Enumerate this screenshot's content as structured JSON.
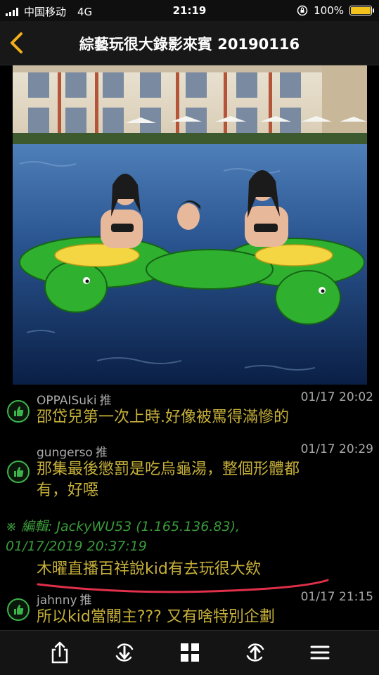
{
  "status": {
    "carrier": "中国移动",
    "network": "4G",
    "time": "21:19",
    "battery": "100%",
    "battery_color": "#f2c21b"
  },
  "nav": {
    "back_icon": "chevron-left-icon",
    "title": "綜藝玩很大錄影來賓 20190116",
    "accent": "#f2b01b"
  },
  "comments": [
    {
      "user": "OPPAISuki",
      "tag": "推",
      "time": "01/17 20:02",
      "text": "邵岱兒第一次上時.好像被罵得滿慘的"
    },
    {
      "user": "gungerso",
      "tag": "推",
      "time": "01/17 20:29",
      "text_lines": [
        "那集最後懲罰是吃烏龜湯，整個形體都",
        "有，好噁"
      ]
    },
    {
      "user": "jahnny",
      "tag": "推",
      "time": "01/17 21:15",
      "text": "所以kid當關主???  又有啥特別企劃"
    }
  ],
  "edit": {
    "line1": "※ 編輯: JackyWU53 (1.165.136.83),",
    "line2": "01/17/2019 20:37:19",
    "body": "木曜直播百祥說kid有去玩很大欸"
  },
  "toolbar": [
    "share-icon",
    "download-refresh-icon",
    "grid-icon",
    "upload-refresh-icon",
    "menu-icon"
  ]
}
